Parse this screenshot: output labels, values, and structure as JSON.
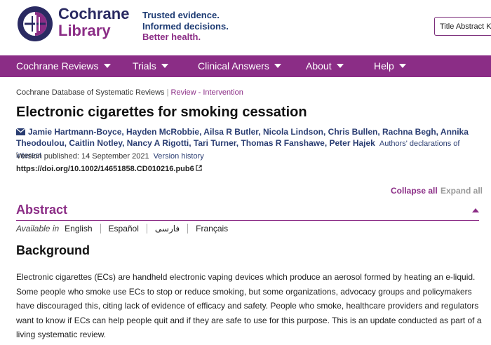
{
  "header": {
    "logo_icon": "cochrane-logo-icon",
    "brand_line1": "Cochrane",
    "brand_line2": "Library",
    "tagline": [
      "Trusted evidence.",
      "Informed decisions.",
      "Better health."
    ],
    "search_select_value": "Title Abstract Keyword"
  },
  "nav": {
    "items": [
      {
        "label": "Cochrane Reviews"
      },
      {
        "label": "Trials"
      },
      {
        "label": "Clinical Answers"
      },
      {
        "label": "About"
      },
      {
        "label": "Help"
      }
    ]
  },
  "breadcrumb": {
    "database": "Cochrane Database of Systematic Reviews",
    "type": "Review - Intervention"
  },
  "article": {
    "title": "Electronic cigarettes for smoking cessation",
    "authors": "Jamie Hartmann-Boyce, Hayden McRobbie, Ailsa R Butler, Nicola Lindson, Chris Bullen, Rachna Begh, Annika Theodoulou, Caitlin Notley, Nancy A Rigotti, Tari Turner, Thomas R Fanshawe, Peter Hajek",
    "declarations_link": "Authors' declarations of interest",
    "version_published": "Version published: 14 September 2021",
    "version_history": "Version history",
    "doi": "https://doi.org/10.1002/14651858.CD010216.pub6"
  },
  "controls": {
    "collapse_all": "Collapse all",
    "expand_all": "Expand all"
  },
  "abstract": {
    "heading": "Abstract",
    "available_in": "Available in",
    "languages": [
      "English",
      "Español",
      "فارسی",
      "Français"
    ],
    "background_heading": "Background",
    "background_text": "Electronic cigarettes (ECs) are handheld electronic vaping devices which produce an aerosol formed by heating an e-liquid. Some people who smoke use ECs to stop or reduce smoking, but some organizations, advocacy groups and policymakers have discouraged this, citing lack of evidence of efficacy and safety. People who smoke, healthcare providers and regulators want to know if ECs can help people quit and if they are safe to use for this purpose. This is an update conducted as part of a living systematic review."
  },
  "colors": {
    "brand_purple": "#8b2d86",
    "brand_navy": "#2a2a62"
  }
}
